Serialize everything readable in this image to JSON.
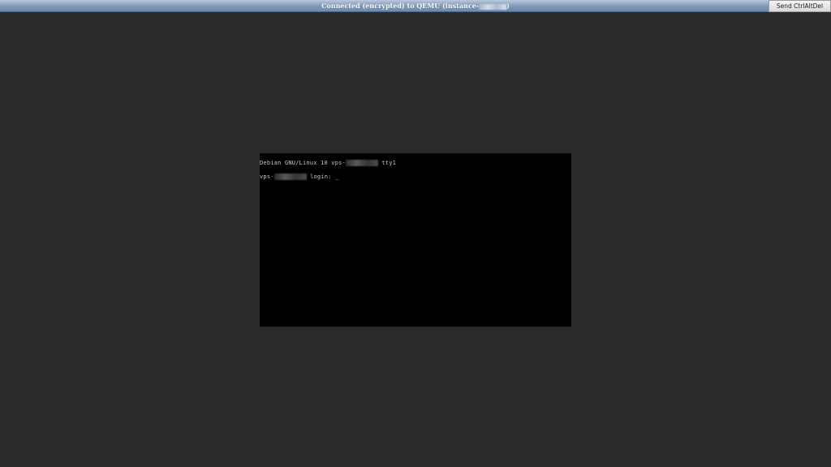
{
  "status_bar": {
    "prefix": "Connected (encrypted) to QEMU (instance-",
    "suffix": ")"
  },
  "send_ctrl_alt_del_label": "Send CtrlAltDel",
  "terminal": {
    "line1_prefix": "Debian GNU/Linux 10 vps-",
    "line1_suffix": " tty1",
    "line2_prefix": "vps-",
    "line2_suffix": " login: ",
    "cursor": "_"
  }
}
